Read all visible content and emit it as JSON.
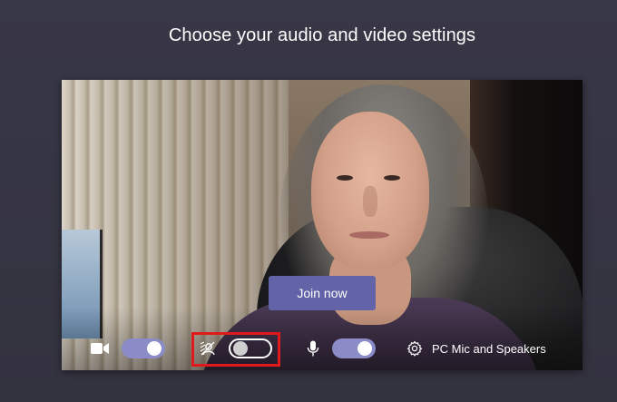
{
  "page": {
    "heading": "Choose your audio and video settings"
  },
  "preview": {
    "join_label": "Join now"
  },
  "controls": {
    "camera": {
      "icon": "camera-icon",
      "state": "on"
    },
    "background_blur": {
      "icon": "background-blur-icon",
      "state": "off"
    },
    "microphone": {
      "icon": "microphone-icon",
      "state": "on"
    },
    "device_settings": {
      "icon": "gear-icon",
      "label": "PC Mic and Speakers"
    }
  },
  "colors": {
    "accent": "#6264a7",
    "toggle_on": "#8b8cc7",
    "highlight": "#e0191d",
    "background": "#33323f"
  }
}
